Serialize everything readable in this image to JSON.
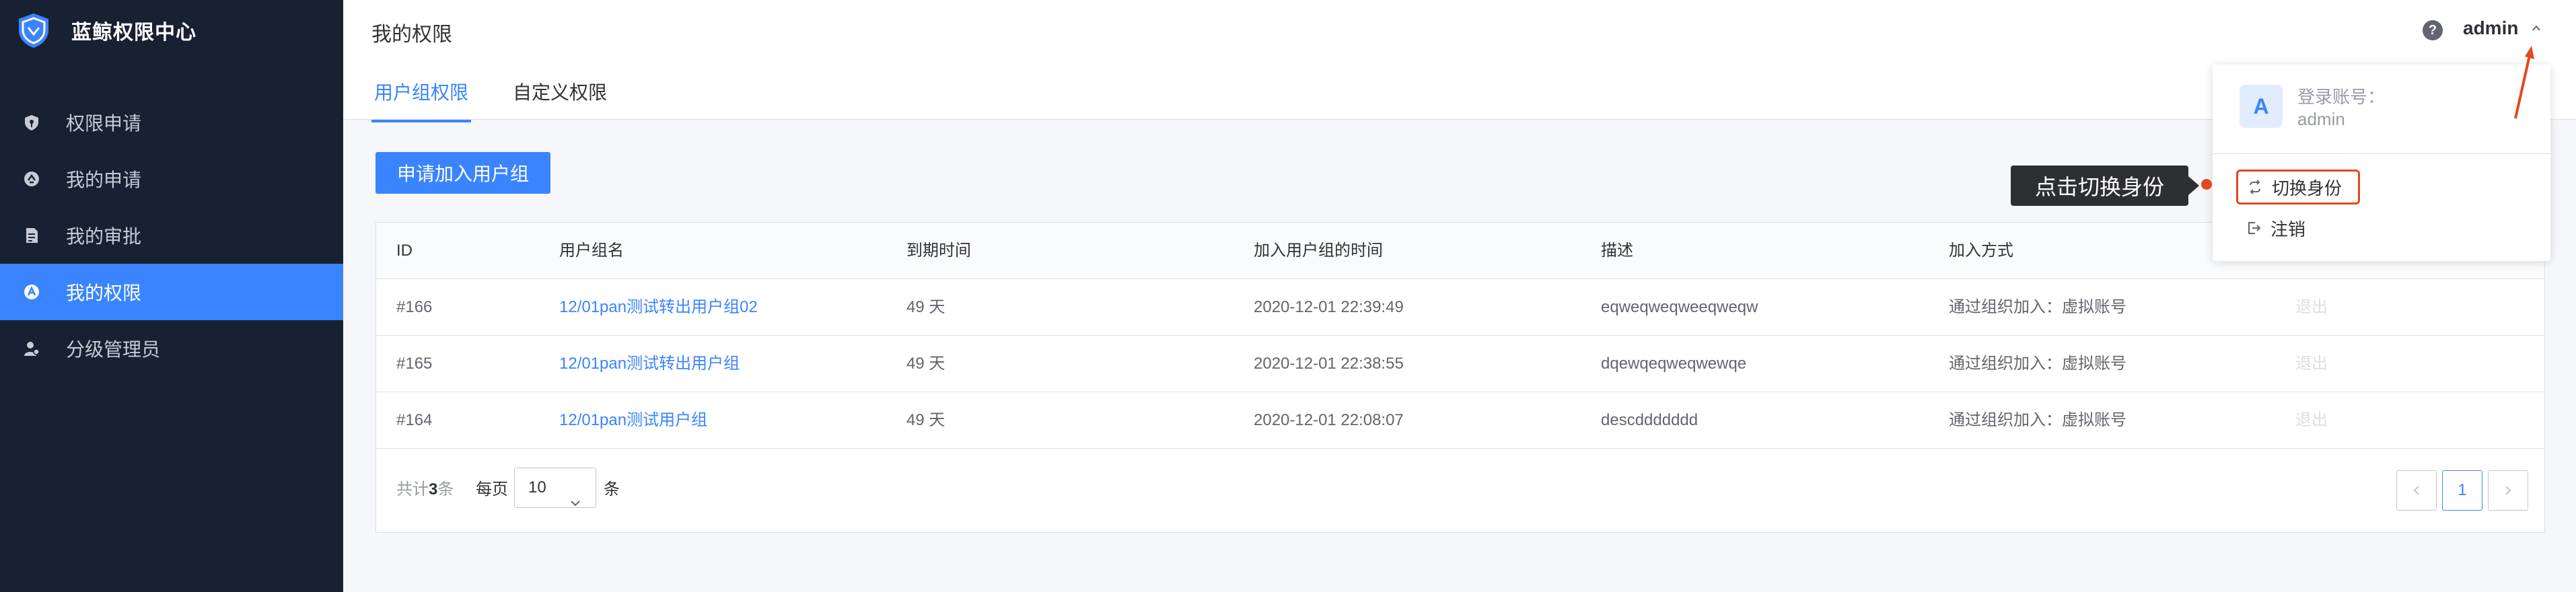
{
  "app": {
    "title": "蓝鲸权限中心"
  },
  "sidebar": {
    "items": [
      {
        "label": "权限申请",
        "icon": "shield-key-icon"
      },
      {
        "label": "我的申请",
        "icon": "apply-icon"
      },
      {
        "label": "我的审批",
        "icon": "document-icon"
      },
      {
        "label": "我的权限",
        "icon": "permission-icon",
        "active": true
      },
      {
        "label": "分级管理员",
        "icon": "admin-icon"
      }
    ]
  },
  "header": {
    "title": "我的权限",
    "tabs": [
      {
        "label": "用户组权限",
        "active": true
      },
      {
        "label": "自定义权限"
      }
    ],
    "help_icon_text": "?",
    "user": "admin"
  },
  "main": {
    "apply_button": "申请加入用户组",
    "table": {
      "columns": [
        "ID",
        "用户组名",
        "到期时间",
        "加入用户组的时间",
        "描述",
        "加入方式"
      ],
      "rows": [
        {
          "id": "#166",
          "name": "12/01pan测试转出用户组02",
          "expire": "49 天",
          "joined": "2020-12-01 22:39:49",
          "desc": "eqweqweqweeqweqw",
          "method": "通过组织加入：虚拟账号",
          "action": "退出"
        },
        {
          "id": "#165",
          "name": "12/01pan测试转出用户组",
          "expire": "49 天",
          "joined": "2020-12-01 22:38:55",
          "desc": "dqewqeqweqwewqe",
          "method": "通过组织加入：虚拟账号",
          "action": "退出"
        },
        {
          "id": "#164",
          "name": "12/01pan测试用户组",
          "expire": "49 天",
          "joined": "2020-12-01 22:08:07",
          "desc": "descddddddd",
          "method": "通过组织加入：虚拟账号",
          "action": "退出"
        }
      ]
    },
    "pagination": {
      "total_prefix": "共计",
      "total": "3",
      "total_suffix": "条",
      "per_page_label": "每页",
      "page_size": "10",
      "unit": "条",
      "current_page": "1"
    }
  },
  "dropdown": {
    "avatar": "A",
    "account_label": "登录账号：",
    "account": "admin",
    "switch_label": "切换身份",
    "logout_label": "注销"
  },
  "annotation": {
    "tooltip": "点击切换身份",
    "color": "#e04a1f"
  },
  "colors": {
    "sidebar_bg": "#182132",
    "accent": "#3a84ff"
  }
}
